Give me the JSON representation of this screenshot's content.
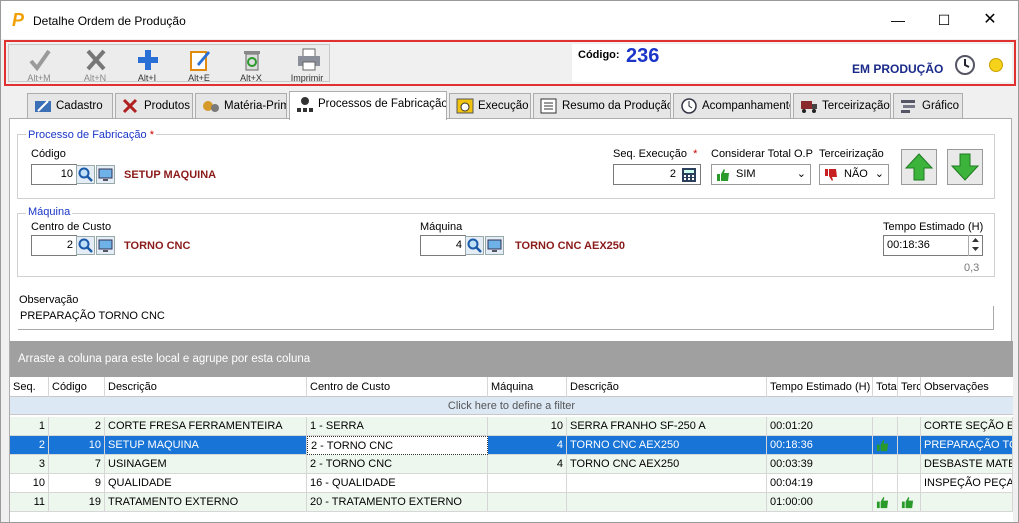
{
  "window": {
    "title": "Detalhe Ordem de Produção"
  },
  "toolbar": {
    "buttons": [
      {
        "label": "Alt+M",
        "icon": "checkmark-icon"
      },
      {
        "label": "Alt+N",
        "icon": "x-icon"
      },
      {
        "label": "Alt+I",
        "icon": "plus-icon"
      },
      {
        "label": "Alt+E",
        "icon": "edit-icon"
      },
      {
        "label": "Alt+X",
        "icon": "trash-icon"
      },
      {
        "label": "Imprimir",
        "icon": "printer-icon"
      }
    ],
    "codigo_label": "Código:",
    "codigo_value": "236",
    "status": "EM PRODUÇÃO"
  },
  "tabs": [
    "Cadastro",
    "Produtos",
    "Matéria-Prim",
    "Processos de Fabricação",
    "Execução",
    "Resumo da Produção",
    "Acompanhamento",
    "Terceirização",
    "Gráfico"
  ],
  "processo": {
    "legend": "Processo de Fabricação",
    "required_mark": "*",
    "codigo_label": "Código",
    "codigo_value": "10",
    "codigo_desc": "SETUP MAQUINA",
    "seq_label": "Seq. Execução",
    "seq_value": "2",
    "considerar_label": "Considerar Total O.P",
    "considerar_value": "SIM",
    "terceirizacao_label": "Terceirização",
    "terceirizacao_value": "NÃO"
  },
  "maquina": {
    "legend": "Máquina",
    "centro_label": "Centro de Custo",
    "centro_value": "2",
    "centro_desc": "TORNO CNC",
    "maquina_label": "Máquina",
    "maquina_value": "4",
    "maquina_desc": "TORNO CNC AEX250",
    "tempo_label": "Tempo Estimado (H)",
    "tempo_value": "00:18:36",
    "tempo_decimal": "0,3"
  },
  "observacao": {
    "label": "Observação",
    "value": "PREPARAÇÃO TORNO CNC"
  },
  "grid": {
    "group_hint": "Arraste a coluna para este local e agrupe por esta coluna",
    "filter_hint": "Click here to define a filter",
    "columns": [
      "Seq.",
      "Código",
      "Descrição",
      "Centro de Custo",
      "Máquina",
      "Descrição",
      "Tempo Estimado (H)",
      "Tota",
      "Terc",
      "Observações"
    ],
    "rows": [
      {
        "seq": "1",
        "codigo": "2",
        "descricao": "CORTE FRESA FERRAMENTEIRA",
        "centro": "1 - SERRA",
        "maquina": "10",
        "maq_desc": "SERRA FRANHO SF-250 A",
        "tempo": "00:01:20",
        "total": "",
        "terc": "",
        "obs": "CORTE SEÇÃO EM"
      },
      {
        "seq": "2",
        "codigo": "10",
        "descricao": "SETUP MAQUINA",
        "centro": "2 - TORNO CNC",
        "maquina": "4",
        "maq_desc": "TORNO CNC AEX250",
        "tempo": "00:18:36",
        "total": "thumb-up",
        "terc": "",
        "obs": "PREPARAÇÃO TOR"
      },
      {
        "seq": "3",
        "codigo": "7",
        "descricao": "USINAGEM",
        "centro": "2 - TORNO CNC",
        "maquina": "4",
        "maq_desc": "TORNO CNC AEX250",
        "tempo": "00:03:39",
        "total": "",
        "terc": "",
        "obs": "DESBASTE MATER"
      },
      {
        "seq": "10",
        "codigo": "9",
        "descricao": "QUALIDADE",
        "centro": "16 - QUALIDADE",
        "maquina": "",
        "maq_desc": "",
        "tempo": "00:04:19",
        "total": "",
        "terc": "",
        "obs": "INSPEÇÃO PEÇA F"
      },
      {
        "seq": "11",
        "codigo": "19",
        "descricao": "TRATAMENTO EXTERNO",
        "centro": "20 - TRATAMENTO EXTERNO",
        "maquina": "",
        "maq_desc": "",
        "tempo": "01:00:00",
        "total": "thumb-up",
        "terc": "thumb-up",
        "obs": ""
      }
    ]
  },
  "colors": {
    "accent": "#1a35c8",
    "selected_row": "#1874d6",
    "desc_text": "#8b1a1a",
    "toolbar_border": "#e03030"
  }
}
